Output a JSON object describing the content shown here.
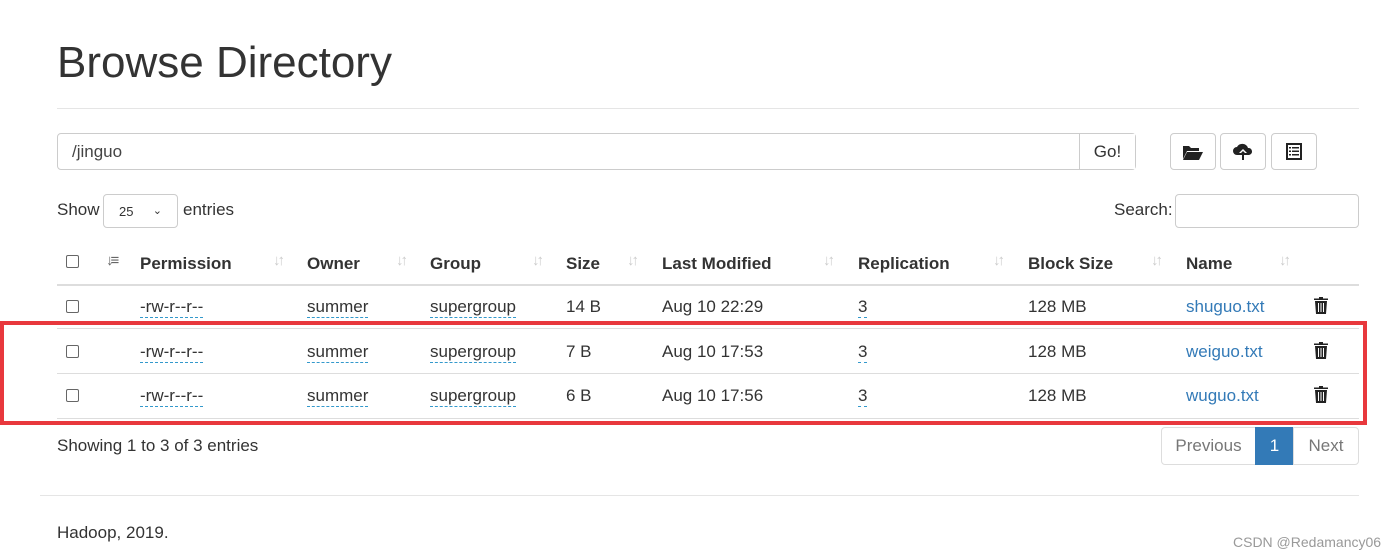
{
  "title": "Browse Directory",
  "path": {
    "value": "/jinguo",
    "go_label": "Go!"
  },
  "toolbar": {
    "icons": [
      "folder-open-icon",
      "cloud-upload-icon",
      "list-alt-icon"
    ]
  },
  "show": {
    "prefix": "Show",
    "value": "25",
    "suffix": "entries"
  },
  "search": {
    "label": "Search:",
    "value": ""
  },
  "columns": [
    "Permission",
    "Owner",
    "Group",
    "Size",
    "Last Modified",
    "Replication",
    "Block Size",
    "Name"
  ],
  "rows": [
    {
      "permission": "-rw-r--r--",
      "owner": "summer",
      "group": "supergroup",
      "size": "14 B",
      "modified": "Aug 10 22:29",
      "replication": "3",
      "block_size": "128 MB",
      "name": "shuguo.txt"
    },
    {
      "permission": "-rw-r--r--",
      "owner": "summer",
      "group": "supergroup",
      "size": "7 B",
      "modified": "Aug 10 17:53",
      "replication": "3",
      "block_size": "128 MB",
      "name": "weiguo.txt"
    },
    {
      "permission": "-rw-r--r--",
      "owner": "summer",
      "group": "supergroup",
      "size": "6 B",
      "modified": "Aug 10 17:56",
      "replication": "3",
      "block_size": "128 MB",
      "name": "wuguo.txt"
    }
  ],
  "info": "Showing 1 to 3 of 3 entries",
  "pagination": {
    "previous": "Previous",
    "current": "1",
    "next": "Next"
  },
  "footer": "Hadoop, 2019.",
  "watermark": "CSDN @Redamancy06",
  "colors": {
    "highlight": "#e8383d",
    "link": "#337ab7",
    "active_page": "#337ab7"
  }
}
